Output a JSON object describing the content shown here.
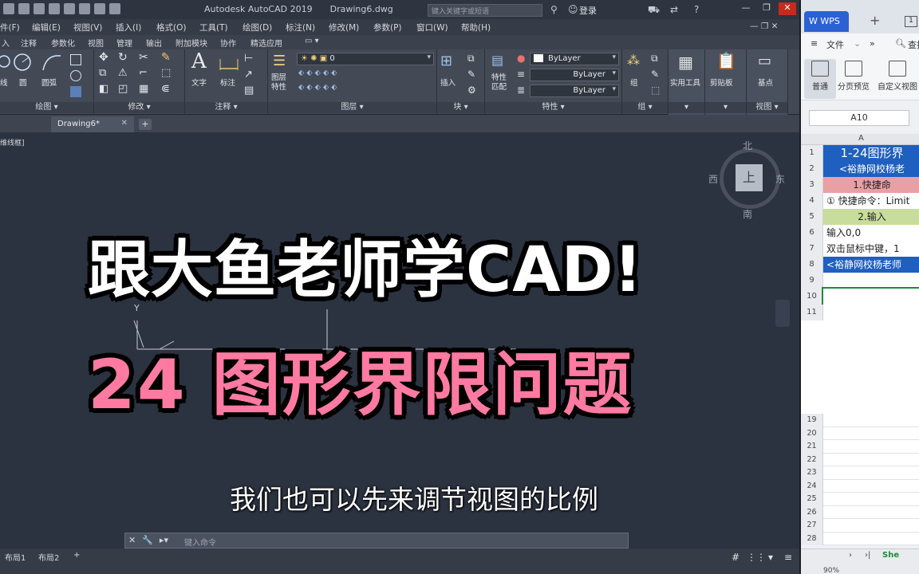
{
  "acad": {
    "title": "Autodesk AutoCAD 2019",
    "doc_name": "Drawing6.dwg",
    "search_placeholder": "键入关键字或短语",
    "login": "登录",
    "menus": [
      "件(F)",
      "编辑(E)",
      "视图(V)",
      "插入(I)",
      "格式(O)",
      "工具(T)",
      "绘图(D)",
      "标注(N)",
      "修改(M)",
      "参数(P)",
      "窗口(W)",
      "帮助(H)"
    ],
    "ribbon_tabs": [
      "入",
      "注释",
      "参数化",
      "视图",
      "管理",
      "输出",
      "附加模块",
      "协作",
      "精选应用"
    ],
    "panels": {
      "draw": {
        "label": "绘图 ▾",
        "tools": [
          "线",
          "圆",
          "圆弧"
        ]
      },
      "modify": {
        "label": "修改 ▾"
      },
      "annot": {
        "label": "注释 ▾",
        "tools": [
          "文字",
          "标注"
        ]
      },
      "layer": {
        "label": "图层 ▾",
        "tool": "图层\n特性",
        "layer_value": "0"
      },
      "block": {
        "label": "块 ▾",
        "tool": "插入"
      },
      "props": {
        "label": "特性 ▾",
        "tool": "特性\n匹配",
        "bylayer": [
          "ByLayer",
          "ByLayer",
          "ByLayer"
        ]
      },
      "group": {
        "label": "组 ▾",
        "tool": "组"
      },
      "util": {
        "tool": "实用工具"
      },
      "clip": {
        "tool": "剪贴板"
      },
      "view": {
        "label": "视图 ▾",
        "tool": "基点"
      }
    },
    "doc_tab": "Drawing6*",
    "viewport_label": "维线框]",
    "viewcube": {
      "n": "北",
      "s": "南",
      "w": "西",
      "e": "东",
      "face": "上"
    },
    "ucs_y": "Y",
    "cmd_placeholder": "键入命令",
    "layout_tabs": [
      "布局1",
      "布局2"
    ]
  },
  "overlay": {
    "title": "跟大鱼老师学CAD!",
    "subtitle": "24 图形界限问题",
    "caption": "我们也可以先来调节视图的比例"
  },
  "wps": {
    "logo": "WPS",
    "menu": [
      "文件",
      "»",
      "查找"
    ],
    "views": [
      "普通",
      "分页预览",
      "自定义视图"
    ],
    "namebox": "A10",
    "col": "A",
    "rows": [
      {
        "n": "1",
        "text": "1-24图形界",
        "bg": "#1f5fbf",
        "fg": "#ffffff"
      },
      {
        "n": "2",
        "text": "<裕静网校杨老",
        "bg": "#1f5fbf",
        "fg": "#ffffff"
      },
      {
        "n": "3",
        "text": "1.快捷命",
        "bg": "#e8a0a4",
        "fg": "#222222"
      },
      {
        "n": "4",
        "text": "① 快捷命令：Limit",
        "bg": "#ffffff",
        "fg": "#222222"
      },
      {
        "n": "5",
        "text": "2.输入",
        "bg": "#c8dc9c",
        "fg": "#222222"
      },
      {
        "n": "6",
        "text": "输入0,0",
        "bg": "#ffffff",
        "fg": "#222222"
      },
      {
        "n": "7",
        "text": "双击鼠标中键，1",
        "bg": "#ffffff",
        "fg": "#222222"
      },
      {
        "n": "8",
        "text": "<裕静网校杨老师",
        "bg": "#1f5fbf",
        "fg": "#ffffff"
      },
      {
        "n": "9",
        "text": "",
        "bg": "#ffffff",
        "fg": "#222222"
      },
      {
        "n": "10",
        "text": "",
        "bg": "#ffffff",
        "fg": "#222222"
      },
      {
        "n": "11",
        "text": "",
        "bg": "#ffffff",
        "fg": "#222222"
      }
    ],
    "row_numbers_bottom": [
      "19",
      "20",
      "21",
      "22",
      "23",
      "24",
      "25",
      "26",
      "27",
      "28"
    ],
    "sheet": "She",
    "zoom": "90%"
  }
}
